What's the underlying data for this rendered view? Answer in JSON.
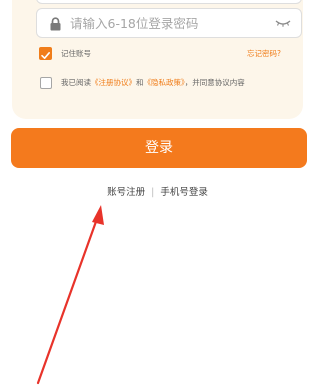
{
  "password": {
    "placeholder": "请输入6-18位登录密码",
    "icon": "lock-icon",
    "toggle_icon": "eye-closed-icon"
  },
  "remember": {
    "label": "记住账号",
    "checked": true
  },
  "forgot_password_label": "忘记密码?",
  "agreement": {
    "prefix": "我已阅读",
    "user_agreement": "《注册协议》",
    "conjunction": "和",
    "privacy_policy": "《隐私政策》",
    "suffix": "，并同意协议内容",
    "checked": false
  },
  "login_button_label": "登录",
  "links": {
    "register": "账号注册",
    "separator": "|",
    "phone_login": "手机号登录"
  },
  "colors": {
    "accent": "#f47a1d",
    "card_background": "#fdf6ea",
    "annotation_arrow": "#e8332a"
  }
}
